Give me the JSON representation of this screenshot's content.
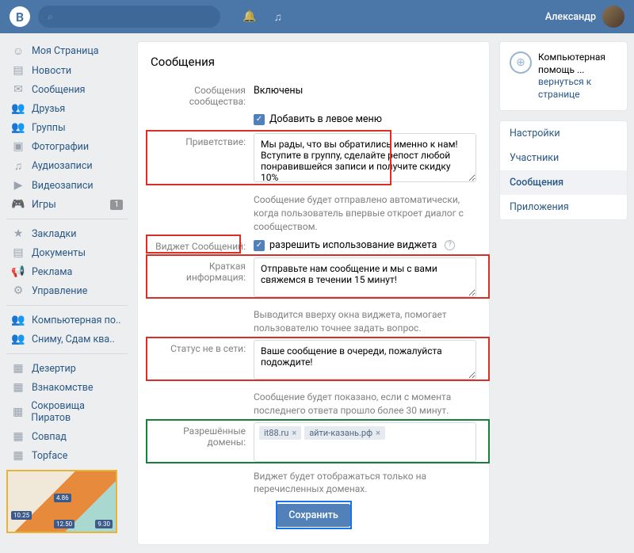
{
  "header": {
    "logo": "B",
    "search_placeholder": "",
    "user_name": "Александр"
  },
  "sidebar": {
    "items": [
      {
        "icon": "☺",
        "label": "Моя Страница"
      },
      {
        "icon": "▤",
        "label": "Новости"
      },
      {
        "icon": "✉",
        "label": "Сообщения"
      },
      {
        "icon": "👥",
        "label": "Друзья"
      },
      {
        "icon": "👥",
        "label": "Группы"
      },
      {
        "icon": "▣",
        "label": "Фотографии"
      },
      {
        "icon": "♫",
        "label": "Аудиозаписи"
      },
      {
        "icon": "▶",
        "label": "Видеозаписи"
      },
      {
        "icon": "🎮",
        "label": "Игры",
        "badge": "1"
      }
    ],
    "items2": [
      {
        "icon": "★",
        "label": "Закладки"
      },
      {
        "icon": "▤",
        "label": "Документы"
      },
      {
        "icon": "📢",
        "label": "Реклама"
      },
      {
        "icon": "⚙",
        "label": "Управление"
      }
    ],
    "items3": [
      {
        "icon": "👥",
        "label": "Компьютерная по.."
      },
      {
        "icon": "👥",
        "label": "Сниму, Сдам ква.."
      }
    ],
    "items4": [
      {
        "icon": "▦",
        "label": "Дезертир"
      },
      {
        "icon": "▦",
        "label": "Взнакомстве"
      },
      {
        "icon": "▦",
        "label": "Сокровища Пиратов"
      },
      {
        "icon": "▦",
        "label": "Совпад"
      },
      {
        "icon": "▦",
        "label": "Topface"
      }
    ],
    "thumb_labels": [
      "10.25",
      "4.86",
      "12.50",
      "9.30"
    ]
  },
  "main": {
    "title": "Сообщения",
    "rows": {
      "community_label": "Сообщения сообщества:",
      "community_value": "Включены",
      "left_menu_cb": "Добавить в левое меню",
      "greeting_label": "Приветствие:",
      "greeting_value": "Мы рады, что вы обратились именно к нам! Вступите в группу, сделайте репост любой понравившейся записи и получите скидку 10%",
      "greeting_hint": "Сообщение будет отправлено автоматически, когда пользователь впервые откроет диалог с сообществом.",
      "widget_label": "Виджет Сообщений:",
      "widget_cb": "разрешить использование виджета",
      "brief_label": "Краткая информация:",
      "brief_value": "Отправьте нам сообщение и мы с вами свяжемся в течении 15 минут!",
      "brief_hint": "Выводится вверху окна виджета, помогает пользователю точнее задать вопрос.",
      "offline_label": "Статус не в сети:",
      "offline_value": "Ваше сообщение в очереди, пожалуйста подождите!",
      "offline_hint": "Сообщение будет показано, если с момента последнего ответа прошло более 30 минут.",
      "domains_label": "Разрешённые домены:",
      "domains": [
        "it88.ru",
        "айти-казань.рф"
      ],
      "domains_hint": "Виджет будет отображаться только на перечисленных доменах.",
      "save_btn": "Сохранить"
    }
  },
  "right": {
    "box_title": "Компьютерная помощь ...",
    "box_sub": "вернуться к странице",
    "nav": [
      "Настройки",
      "Участники",
      "Сообщения",
      "Приложения"
    ]
  }
}
